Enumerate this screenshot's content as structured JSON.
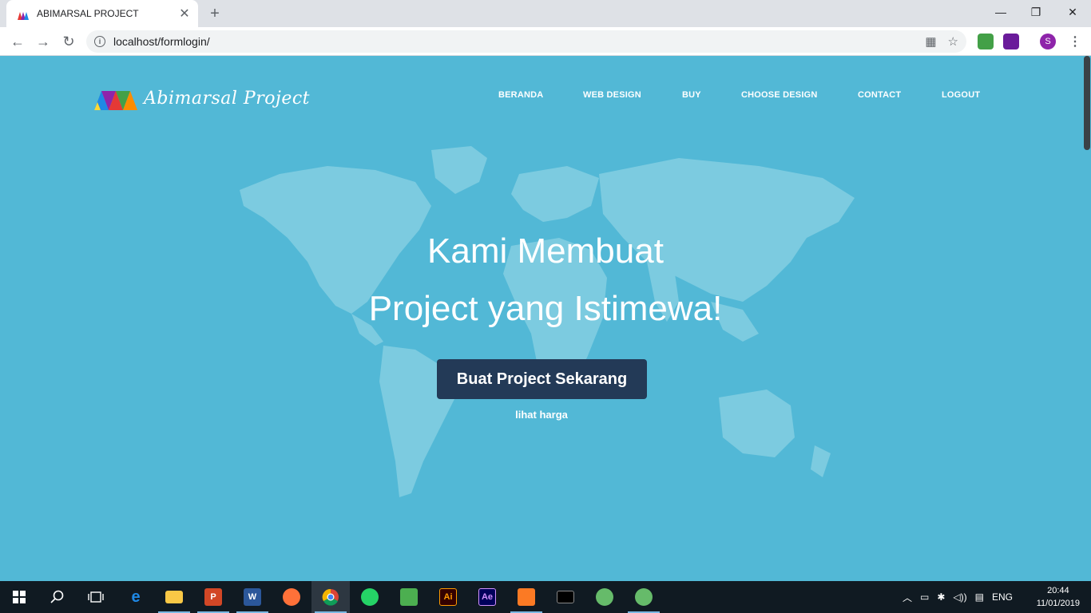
{
  "browser": {
    "tab_title": "ABIMARSAL PROJECT",
    "url": "localhost/formlogin/",
    "profile_initial": "S"
  },
  "site": {
    "logo_text": "Abimarsal Project",
    "nav": [
      {
        "label": "BERANDA"
      },
      {
        "label": "WEB DESIGN"
      },
      {
        "label": "BUY"
      },
      {
        "label": "CHOOSE DESIGN"
      },
      {
        "label": "CONTACT"
      },
      {
        "label": "LOGOUT"
      }
    ],
    "hero_line1": "Kami Membuat",
    "hero_line2": "Project yang Istimewa!",
    "cta_label": "Buat Project Sekarang",
    "sub_link": "lihat harga",
    "colors": {
      "background": "#52b8d6",
      "cta": "#233a57",
      "map": "#7ccbe0"
    }
  },
  "taskbar": {
    "language": "ENG",
    "time": "20:44",
    "date": "11/01/2019",
    "apps": [
      "windows-start",
      "search",
      "task-view",
      "edge",
      "file-explorer",
      "powerpoint",
      "word",
      "firefox",
      "chrome",
      "whatsapp",
      "sublime",
      "illustrator",
      "after-effects",
      "xampp",
      "terminal",
      "atom",
      "atom"
    ]
  }
}
